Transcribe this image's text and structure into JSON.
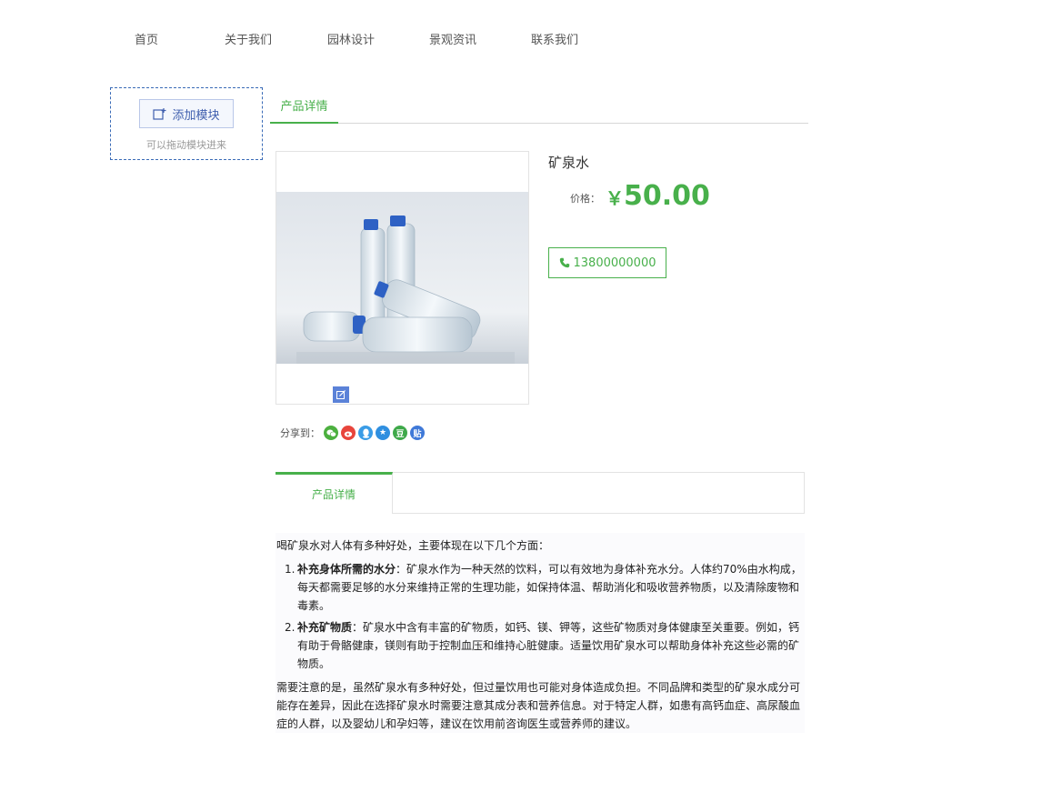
{
  "nav": {
    "items": [
      "首页",
      "关于我们",
      "园林设计",
      "景观资讯",
      "联系我们"
    ]
  },
  "module_box": {
    "add_label": "添加模块",
    "hint": "可以拖动模块进来"
  },
  "tabstrip": {
    "tab_label": "产品详情"
  },
  "product": {
    "name": "矿泉水",
    "price_label": "价格：",
    "currency": "￥",
    "price": "50.00",
    "phone": "13800000000"
  },
  "share": {
    "label": "分享到：",
    "icons": [
      {
        "name": "wechat-icon",
        "color": "#4cb03f",
        "glyph": ""
      },
      {
        "name": "weibo-icon",
        "color": "#e8453c",
        "glyph": ""
      },
      {
        "name": "qq-icon",
        "color": "#3a9ce6",
        "glyph": ""
      },
      {
        "name": "qzone-icon",
        "color": "#2f8fe0",
        "glyph": "★"
      },
      {
        "name": "douban-icon",
        "color": "#3fa94a",
        "glyph": "豆"
      },
      {
        "name": "tieba-icon",
        "color": "#3f79d8",
        "glyph": "贴"
      }
    ]
  },
  "detail": {
    "tab_label": "产品详情",
    "intro": "喝矿泉水对人体有多种好处，主要体现在以下几个方面：",
    "points": [
      {
        "num": "1.",
        "title": "补充身体所需的水分",
        "text": "：矿泉水作为一种天然的饮料，可以有效地为身体补充水分。人体约70%由水构成，每天都需要足够的水分来维持正常的生理功能，如保持体温、帮助消化和吸收营养物质，以及清除废物和毒素。"
      },
      {
        "num": "2.",
        "title": "补充矿物质",
        "text": "：矿泉水中含有丰富的矿物质，如钙、镁、钾等，这些矿物质对身体健康至关重要。例如，钙有助于骨骼健康，镁则有助于控制血压和维持心脏健康。适量饮用矿泉水可以帮助身体补充这些必需的矿物质。"
      }
    ],
    "outro": "需要注意的是，虽然矿泉水有多种好处，但过量饮用也可能对身体造成负担。不同品牌和类型的矿泉水成分可能存在差异，因此在选择矿泉水时需要注意其成分表和营养信息。对于特定人群，如患有高钙血症、高尿酸血症的人群，以及婴幼儿和孕妇等，建议在饮用前咨询医生或营养师的建议。"
  },
  "colors": {
    "accent": "#48b04b",
    "module_border": "#3a6bb7",
    "edit_icon": "#5b82d8"
  }
}
